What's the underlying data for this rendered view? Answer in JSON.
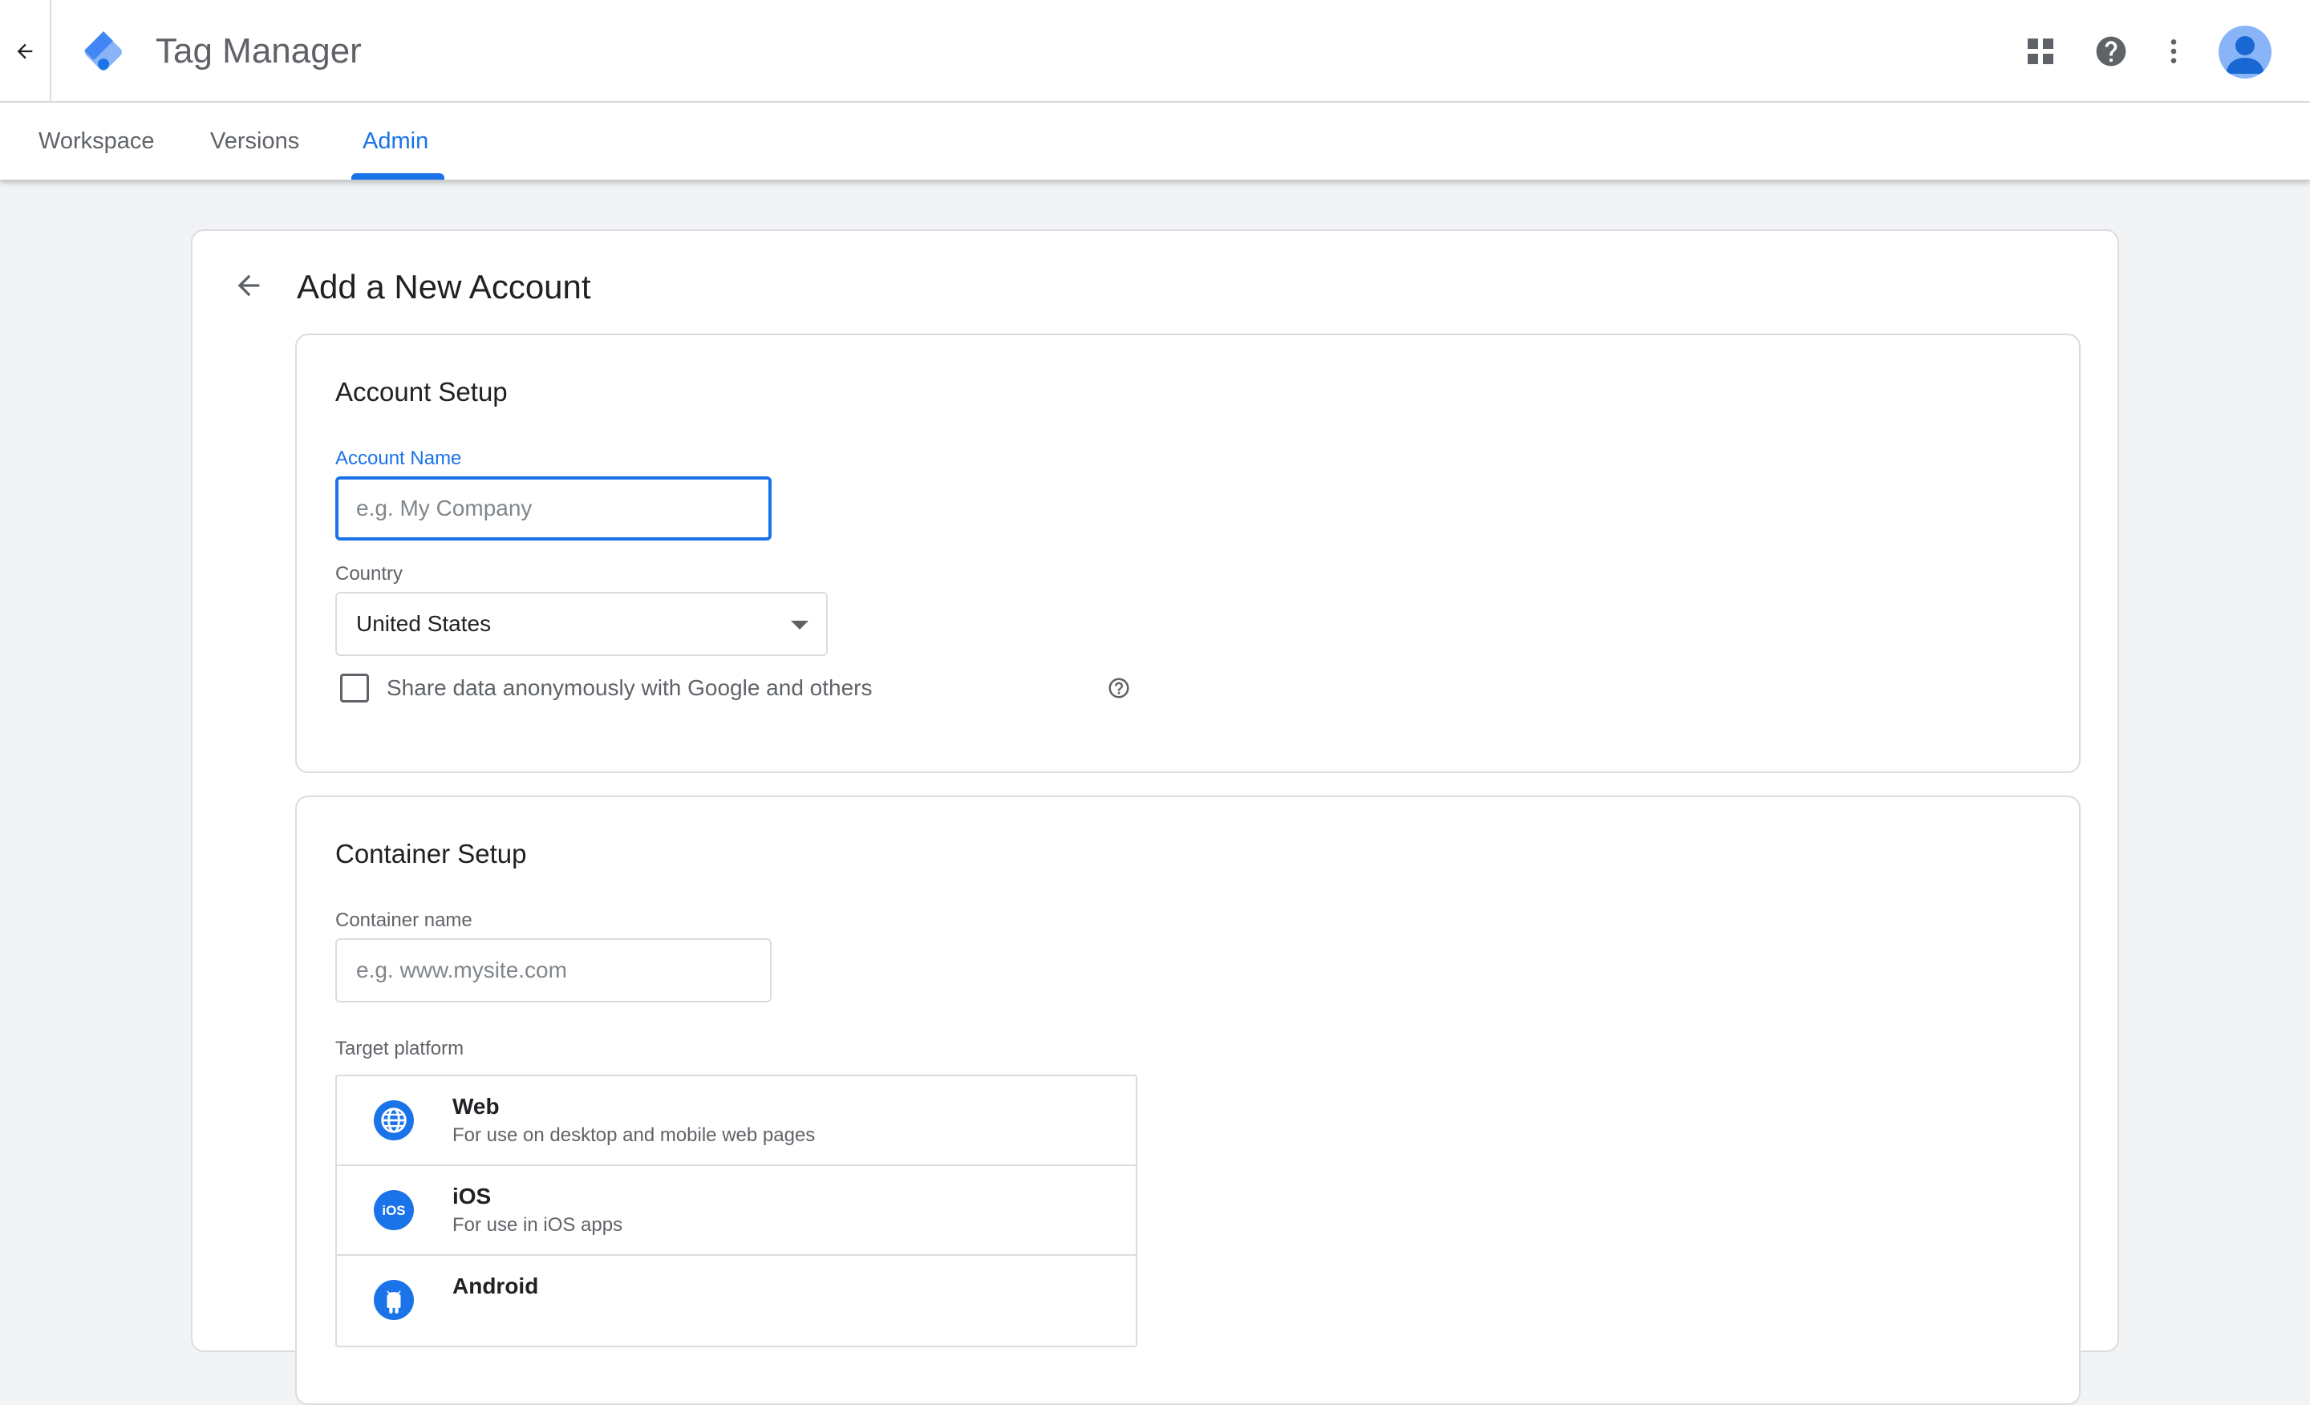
{
  "app": {
    "title": "Tag Manager"
  },
  "tabs": [
    {
      "label": "Workspace"
    },
    {
      "label": "Versions"
    },
    {
      "label": "Admin"
    }
  ],
  "page": {
    "title": "Add a New Account"
  },
  "account_setup": {
    "title": "Account Setup",
    "account_name_label": "Account Name",
    "account_name_placeholder": "e.g. My Company",
    "account_name_value": "",
    "country_label": "Country",
    "country_value": "United States",
    "share_data_label": "Share data anonymously with Google and others",
    "share_data_checked": false
  },
  "container_setup": {
    "title": "Container Setup",
    "container_name_label": "Container name",
    "container_name_placeholder": "e.g. www.mysite.com",
    "target_platform_label": "Target platform",
    "platforms": [
      {
        "name": "Web",
        "description": "For use on desktop and mobile web pages",
        "icon": "globe-icon"
      },
      {
        "name": "iOS",
        "description": "For use in iOS apps",
        "icon": "ios-icon"
      },
      {
        "name": "Android",
        "description": "",
        "icon": "android-icon"
      }
    ]
  },
  "colors": {
    "accent": "#1a73e8",
    "border": "#dadce0",
    "background": "#f1f3f4"
  }
}
